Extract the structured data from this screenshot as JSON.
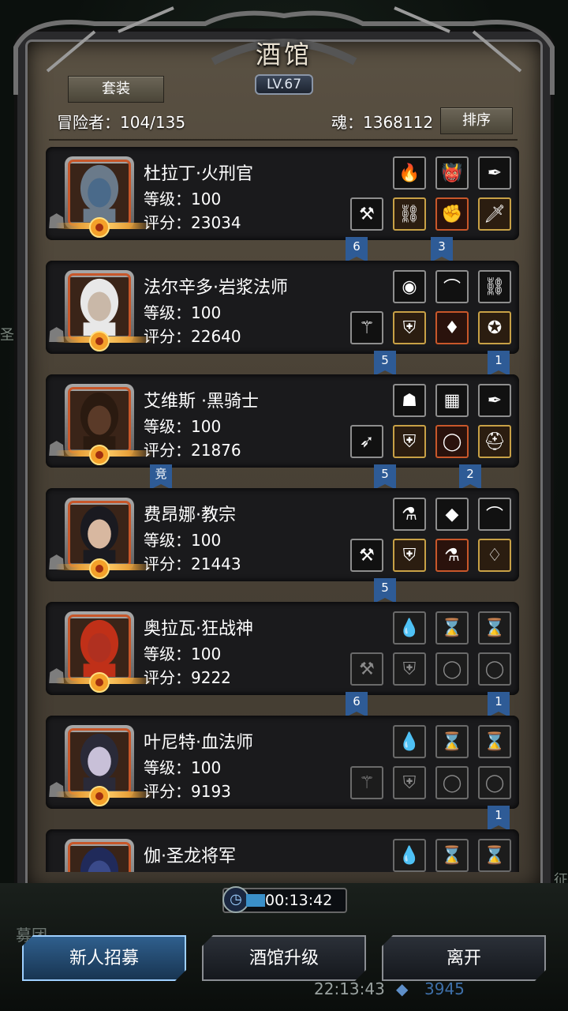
{
  "header": {
    "title": "酒馆",
    "level": "LV.67",
    "outfit_button": "套装",
    "sort_button": "排序",
    "adventurers": "冒险者：104/135",
    "souls": "魂：1368112"
  },
  "heroes": [
    {
      "name": "杜拉丁·火刑官",
      "level": "等级：100",
      "score": "评分：23034",
      "tags": [
        {
          "text": "6"
        },
        {
          "text": "3"
        }
      ],
      "slots_top": [
        "fire-orb",
        "purple-demon",
        "dark-feather"
      ],
      "slots_bottom": [
        "axe",
        "armor",
        "gauntlet",
        "sword"
      ]
    },
    {
      "name": "法尔辛多·岩浆法师",
      "level": "等级：100",
      "score": "评分：22640",
      "tags": [
        {
          "text": "5"
        },
        {
          "text": "1"
        }
      ],
      "slots_top": [
        "blue-orb",
        "dark-bow",
        "dark-chain"
      ],
      "slots_bottom": [
        "staff",
        "plate-armor",
        "amulet",
        "medallion"
      ]
    },
    {
      "name": "艾维斯 ·黑骑士",
      "level": "等级：100",
      "score": "评分：21876",
      "tags": [
        {
          "text": "竞"
        },
        {
          "text": "5"
        },
        {
          "text": "2"
        }
      ],
      "slots_top": [
        "gold-mask",
        "chain-mail",
        "dark-feather"
      ],
      "slots_bottom": [
        "bow",
        "red-armor",
        "ring",
        "helmet"
      ]
    },
    {
      "name": "费昂娜·教宗",
      "level": "等级：100",
      "score": "评分：21443",
      "tags": [
        {
          "text": "5"
        }
      ],
      "slots_top": [
        "red-flask",
        "purple-gem",
        "dark-bow"
      ],
      "slots_bottom": [
        "mace",
        "robe",
        "potion",
        "pendant"
      ]
    },
    {
      "name": "奥拉瓦·狂战神",
      "level": "等级：100",
      "score": "评分：9222",
      "tags": [
        {
          "text": "6"
        },
        {
          "text": "1"
        }
      ],
      "slots_top": [
        "empty-drop",
        "empty-hourglass",
        "empty-hourglass"
      ],
      "slots_bottom": [
        "empty-axe",
        "empty-armor",
        "empty-ring",
        "empty-ring"
      ]
    },
    {
      "name": "叶尼特·血法师",
      "level": "等级：100",
      "score": "评分：9193",
      "tags": [
        {
          "text": "1"
        }
      ],
      "slots_top": [
        "empty-drop",
        "empty-hourglass",
        "empty-hourglass"
      ],
      "slots_bottom": [
        "empty-staff",
        "empty-armor",
        "empty-ring",
        "empty-ring"
      ]
    },
    {
      "name": "伽·圣龙将军",
      "level": "",
      "score": "",
      "tags": [],
      "slots_top": [
        "empty-drop",
        "empty-hourglass",
        "empty-hourglass"
      ],
      "slots_bottom": []
    }
  ],
  "timer": "00:13:42",
  "buttons": {
    "recruit": "新人招募",
    "upgrade": "酒馆升级",
    "leave": "离开"
  },
  "background": {
    "left_text": "圣迹",
    "right_text": "征",
    "bottom_label": "募团",
    "clock": "22:13:43",
    "coins": "3945"
  },
  "colors": {
    "accent": "#2e5b96",
    "panel": "#4a4236",
    "portrait_border": "#c8572a",
    "gold": "#c8a146"
  }
}
